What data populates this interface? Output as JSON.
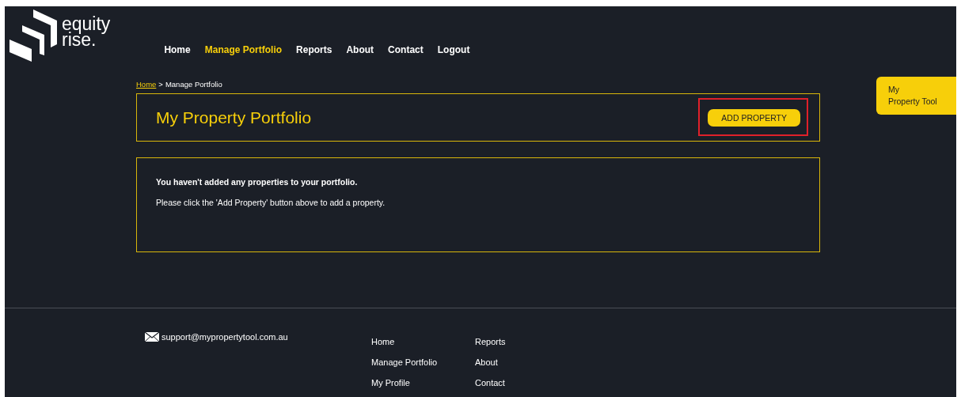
{
  "logo": {
    "line_1": "equity",
    "line_2": "rise."
  },
  "nav": [
    {
      "label": "Home",
      "selected": false
    },
    {
      "label": "Manage Portfolio",
      "selected": true
    },
    {
      "label": "Reports",
      "selected": false
    },
    {
      "label": "About",
      "selected": false
    },
    {
      "label": "Contact",
      "selected": false
    },
    {
      "label": "Logout",
      "selected": false
    }
  ],
  "breadcrumb": {
    "link": "Home",
    "separator": ">",
    "current": "Manage Portfolio"
  },
  "header": {
    "title": "My Property Portfolio",
    "button": "ADD PROPERTY"
  },
  "side_tab": {
    "line_1": "My",
    "line_2": "Property Tool"
  },
  "message": {
    "heading": "You haven't added any properties to your portfolio.",
    "body": "Please click the 'Add Property' button above to add a property."
  },
  "footer": {
    "email": "support@mypropertytool.com.au",
    "links_col_1": [
      "Home",
      "Manage Portfolio",
      "My Profile"
    ],
    "links_col_2": [
      "Reports",
      "About",
      "Contact"
    ]
  }
}
